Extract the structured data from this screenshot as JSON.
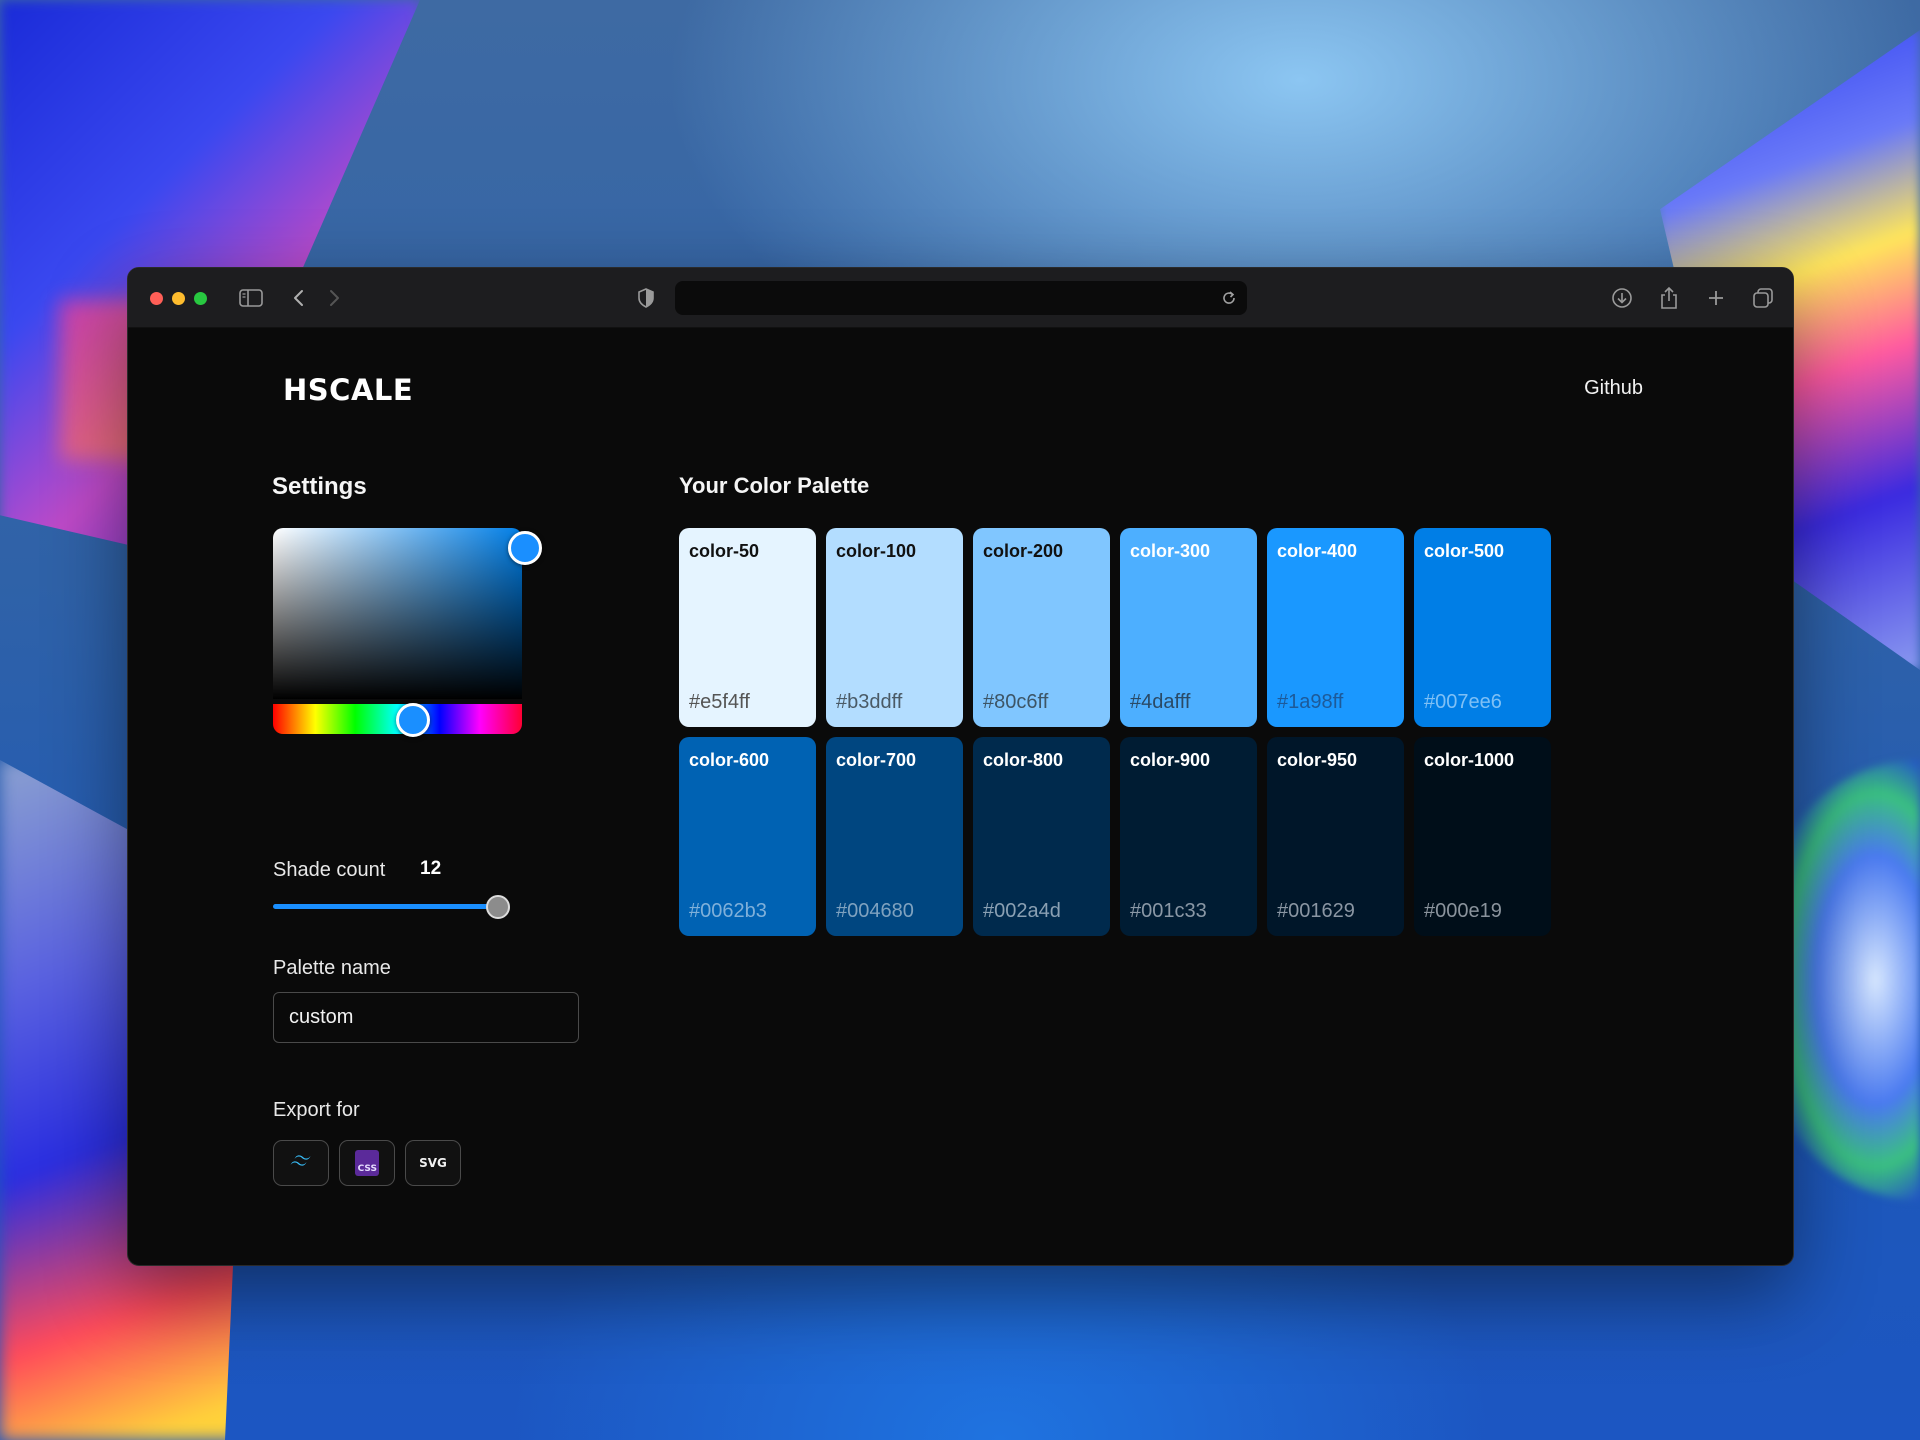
{
  "app": {
    "logo": "HSCALE",
    "github_link": "Github"
  },
  "settings": {
    "heading": "Settings",
    "picker": {
      "selected_color": "#007ee6"
    },
    "shade_count_label": "Shade count",
    "shade_count_value": "12",
    "palette_name_label": "Palette name",
    "palette_name_value": "custom",
    "export_label": "Export for",
    "export_buttons": [
      {
        "icon": "tailwind-icon"
      },
      {
        "icon": "css-icon",
        "text": "CSS"
      },
      {
        "icon": "svg-icon",
        "text": "SVG"
      }
    ]
  },
  "palette": {
    "heading": "Your Color Palette",
    "swatches": [
      {
        "name": "color-50",
        "hex": "#e5f4ff",
        "name_color": "#111111",
        "hex_color": "#555555"
      },
      {
        "name": "color-100",
        "hex": "#b3ddff",
        "name_color": "#111111",
        "hex_color": "#4a5a66"
      },
      {
        "name": "color-200",
        "hex": "#80c6ff",
        "name_color": "#111111",
        "hex_color": "#3d5566"
      },
      {
        "name": "color-300",
        "hex": "#4dafff",
        "name_color": "#ffffff",
        "hex_color": "#2a4a66"
      },
      {
        "name": "color-400",
        "hex": "#1a98ff",
        "name_color": "#ffffff",
        "hex_color": "#1d5a99"
      },
      {
        "name": "color-500",
        "hex": "#007ee6",
        "name_color": "#ffffff",
        "hex_color": "#7fc0f5"
      },
      {
        "name": "color-600",
        "hex": "#0062b3",
        "name_color": "#ffffff",
        "hex_color": "#7fb0da"
      },
      {
        "name": "color-700",
        "hex": "#004680",
        "name_color": "#ffffff",
        "hex_color": "#7fa2bf"
      },
      {
        "name": "color-800",
        "hex": "#002a4d",
        "name_color": "#ffffff",
        "hex_color": "#8aa0b3"
      },
      {
        "name": "color-900",
        "hex": "#001c33",
        "name_color": "#ffffff",
        "hex_color": "#8a98a6"
      },
      {
        "name": "color-950",
        "hex": "#001629",
        "name_color": "#ffffff",
        "hex_color": "#8a96a3"
      },
      {
        "name": "color-1000",
        "hex": "#000e19",
        "name_color": "#ffffff",
        "hex_color": "#8a939c"
      }
    ]
  }
}
